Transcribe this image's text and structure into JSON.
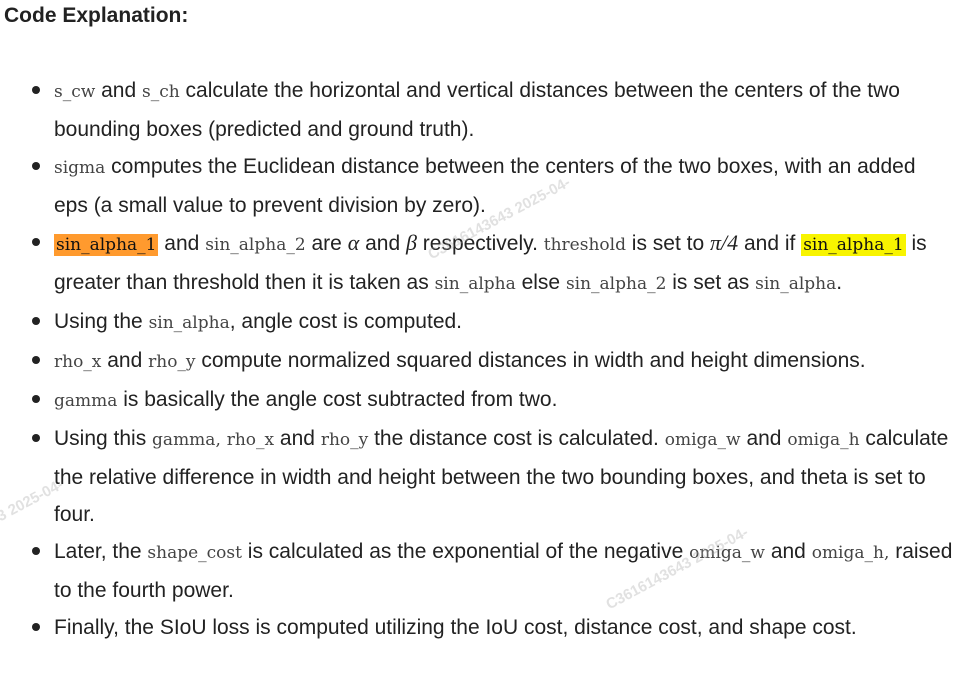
{
  "heading": "Code Explanation:",
  "items": [
    {
      "c1": "s_cw",
      "t1": " and ",
      "c2": "s_ch",
      "t2": " calculate the horizontal and vertical distances between the centers of the two bounding boxes (predicted and ground truth)."
    },
    {
      "c1": "sigma",
      "t1": " computes the Euclidean distance between the centers of the two boxes, with an added eps (a small value to prevent division by zero)."
    },
    {
      "h1": "sin_alpha_1",
      "t1": " and ",
      "c1": "sin_alpha_2",
      "t2": " are ",
      "m1": "α",
      "t3": " and ",
      "m2": "β",
      "t4": " respectively. ",
      "c2": "threshold",
      "t5": " is set to ",
      "m3": "π/4",
      "t6": " and if ",
      "h2": "sin_alpha_1",
      "t7": " is greater than threshold then it is taken as ",
      "c3": "sin_alpha",
      "t8": " else ",
      "c4": "sin_alpha_2",
      "t9": " is set as ",
      "c5": "sin_alpha",
      "t10": "."
    },
    {
      "t1": "Using the ",
      "c1": "sin_alpha",
      "t2": ", angle cost is computed."
    },
    {
      "c1": "rho_x",
      "t1": " and ",
      "c2": "rho_y",
      "t2": " compute normalized squared distances in width and height dimensions."
    },
    {
      "c1": "gamma",
      "t1": " is basically the angle cost subtracted from two."
    },
    {
      "t1": "Using this ",
      "c1": "gamma,",
      "t2": " ",
      "c2": "rho_x",
      "t3": " and ",
      "c3": "rho_y",
      "t4": " the distance cost is calculated. ",
      "c4": "omiga_w",
      "t5": " and ",
      "c5": "omiga_h",
      "t6": " calculate the relative difference in width and height between the two bounding boxes, and theta is set to four."
    },
    {
      "t1": "Later, the ",
      "c1": "shape_cost",
      "t2": " is calculated as the exponential of the negative ",
      "c2": "omiga_w",
      "t3": " and ",
      "c3": "omiga_h,",
      "t4": " raised to the fourth power."
    },
    {
      "t1": "Finally, the SIoU loss is computed utilizing the IoU cost, distance cost, and shape cost."
    }
  ],
  "highlight_colors": {
    "orange": "#ff9a2e",
    "yellow": "#f8f400"
  },
  "watermarks": [
    "C3616143643 2025-04-",
    "3 2025-04-",
    "C3616143643 2025-04-"
  ]
}
